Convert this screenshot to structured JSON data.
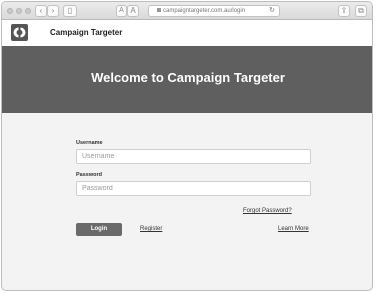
{
  "browser": {
    "url": "campaigntargeter.com.au/login",
    "text_small_label": "A",
    "text_large_label": "A",
    "nav_back_icon": "chevron-left-icon",
    "nav_forward_icon": "chevron-right-icon",
    "sidebar_icon": "sidebar-icon",
    "share_icon": "share-icon",
    "tabs_icon": "tabs-icon",
    "reload_icon": "reload-icon"
  },
  "header": {
    "brand": "Campaign Targeter",
    "logo_icon": "campaign-targeter-logo-icon"
  },
  "hero": {
    "title": "Welcome to Campaign Targeter",
    "background": "#5f5f5f"
  },
  "form": {
    "username_label": "Username",
    "username_placeholder": "Username",
    "password_label": "Password",
    "password_placeholder": "Password",
    "forgot_label": "Forgot Password?",
    "login_label": "Login",
    "register_label": "Register",
    "learn_more_label": "Learn More"
  }
}
